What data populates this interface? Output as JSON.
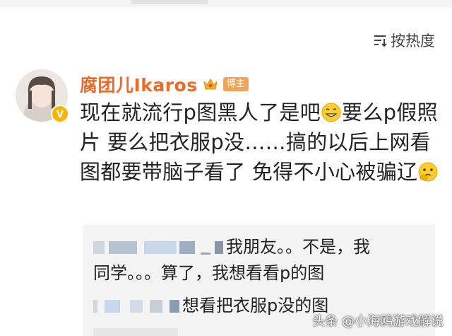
{
  "sort": {
    "label": "按热度",
    "icon": "sort-icon"
  },
  "post": {
    "username": "腐团儿Ikaros",
    "user_tag": "博主",
    "text_part1": "现在就流行p图黑人了是吧",
    "text_part2": "要么p假照片 要么把衣服p没……搞的以后上网看图都要带脑子看了 免得不小心被骗",
    "text_part3": "辽"
  },
  "replies": {
    "reply1_text_a": "我朋友。。不是，我",
    "reply1_text_b": "同学。。。算了，我想看看p的图",
    "reply2_text": "想看把衣服p没的图"
  },
  "watermark": {
    "text": "头条 @小海鸥游戏解说"
  },
  "colors": {
    "username": "#e86c2c",
    "tag_bg": "#f2a45b",
    "quote_bg": "#f4f4f4",
    "crown": "#f2b01e"
  }
}
